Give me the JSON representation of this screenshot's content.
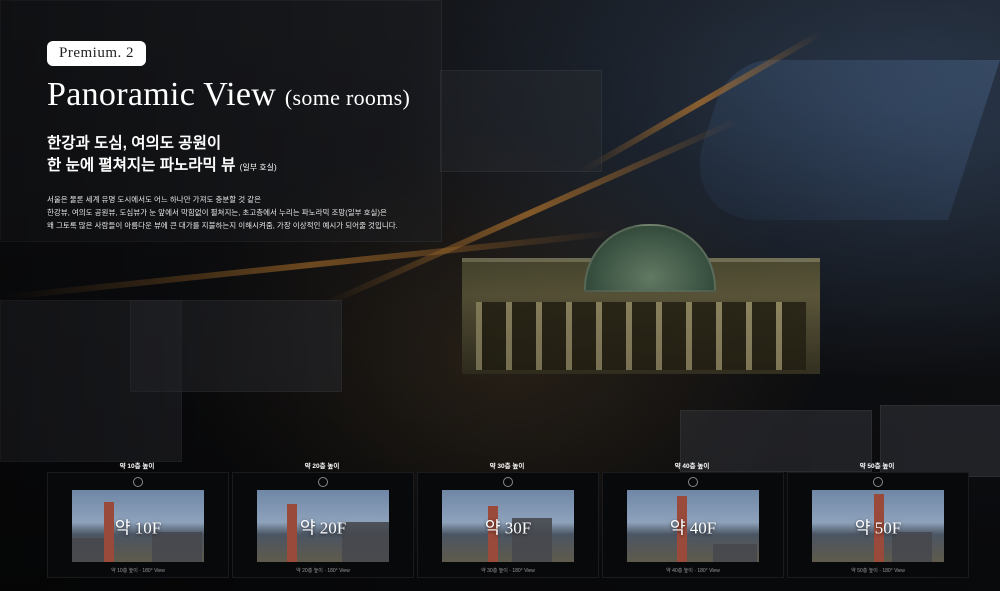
{
  "badge": "Premium. 2",
  "headline": {
    "main": "Panoramic View",
    "sub": "(some rooms)"
  },
  "korean": {
    "line1": "한강과 도심, 여의도 공원이",
    "line2": "한 눈에 펼쳐지는 파노라믹 뷰",
    "note": "(일부 호실)"
  },
  "description": {
    "line1": "서울은 물론 세계 유명 도시에서도 어느 하나만 가져도 충분할 것 같은",
    "line2": "한강뷰, 여의도 공원뷰, 도심뷰가 눈 앞에서 막힘없이 펼쳐지는, 초고층에서 누리는 파노라믹 조망(일부 호실)은",
    "line3": "왜 그토록 많은 사람들이 아름다운 뷰에 큰 대가를 지불하는지 이해시켜줌, 가장 이상적인 예시가 되어줄 것입니다."
  },
  "cards": [
    {
      "label": "약 10층 높이",
      "floor": "약 10F",
      "caption": "약 10층 높이 · 180° View"
    },
    {
      "label": "약 20층 높이",
      "floor": "약 20F",
      "caption": "약 20층 높이 · 180° View"
    },
    {
      "label": "약 30층 높이",
      "floor": "약 30F",
      "caption": "약 30층 높이 · 180° View"
    },
    {
      "label": "약 40층 높이",
      "floor": "약 40F",
      "caption": "약 40층 높이 · 180° View"
    },
    {
      "label": "약 50층 높이",
      "floor": "약 50F",
      "caption": "약 50층 높이 · 180° View"
    }
  ]
}
